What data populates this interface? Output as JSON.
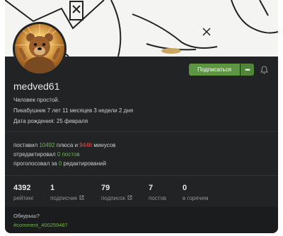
{
  "profile": {
    "username": "medved61",
    "about": "Человек простой.",
    "tenure": "Пикабушник 7 лет 11 месяцев 3 недели 2 дня",
    "birthday": "Дата рождения: 25 февраля"
  },
  "actions": {
    "subscribe_label": "Подписаться",
    "more_label": "•••"
  },
  "activity": {
    "voted_prefix": "поставил",
    "pluses": "10492",
    "pluses_mid": "плюса и",
    "minuses": "9446",
    "minuses_suffix": "минусов",
    "moderated_prefix": "отредактировал",
    "moderated_value": "0 постов",
    "voted_edits_prefix": "проголосовал за",
    "voted_edits_value": "0",
    "voted_edits_suffix": "редактирований"
  },
  "stats": [
    {
      "value": "4392",
      "label": "рейтинг"
    },
    {
      "value": "1",
      "label": "подписчик"
    },
    {
      "value": "79",
      "label": "подписок"
    },
    {
      "value": "7",
      "label": "постов"
    },
    {
      "value": "0",
      "label": "в горячем"
    }
  ],
  "footer": {
    "question": "Обкурыш?",
    "link": "#comment_400259487"
  },
  "colors": {
    "accent_green": "#5c9645",
    "positive": "#6fb54f",
    "negative": "#e2554a",
    "card_bg": "#222324"
  },
  "icons": [
    "bell-icon",
    "external-link-icon",
    "avatar-bear-image"
  ]
}
